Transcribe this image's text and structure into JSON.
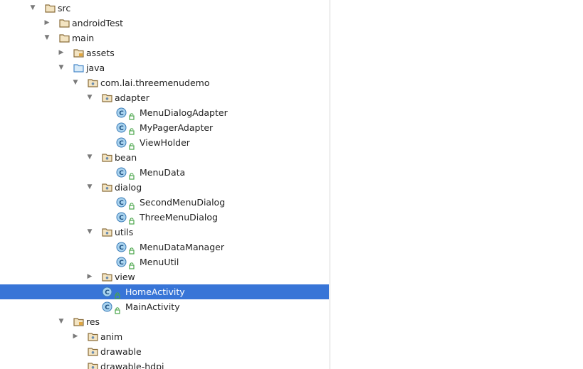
{
  "tree": {
    "rows": [
      {
        "label": "src",
        "icon": "folder-icon",
        "toggle": "expanded",
        "depth": 0,
        "locked": false,
        "selected": false
      },
      {
        "label": "androidTest",
        "icon": "folder-icon",
        "toggle": "collapsed",
        "depth": 1,
        "locked": false,
        "selected": false
      },
      {
        "label": "main",
        "icon": "folder-icon",
        "toggle": "expanded",
        "depth": 1,
        "locked": false,
        "selected": false
      },
      {
        "label": "assets",
        "icon": "resource-folder-icon",
        "toggle": "collapsed",
        "depth": 2,
        "locked": false,
        "selected": false
      },
      {
        "label": "java",
        "icon": "source-folder-icon",
        "toggle": "expanded",
        "depth": 2,
        "locked": false,
        "selected": false
      },
      {
        "label": "com.lai.threemenudemo",
        "icon": "package-icon",
        "toggle": "expanded",
        "depth": 3,
        "locked": false,
        "selected": false
      },
      {
        "label": "adapter",
        "icon": "package-icon",
        "toggle": "expanded",
        "depth": 4,
        "locked": false,
        "selected": false
      },
      {
        "label": "MenuDialogAdapter",
        "icon": "class-icon",
        "toggle": "none",
        "depth": 5,
        "locked": true,
        "selected": false
      },
      {
        "label": "MyPagerAdapter",
        "icon": "class-icon",
        "toggle": "none",
        "depth": 5,
        "locked": true,
        "selected": false
      },
      {
        "label": "ViewHolder",
        "icon": "class-icon",
        "toggle": "none",
        "depth": 5,
        "locked": true,
        "selected": false
      },
      {
        "label": "bean",
        "icon": "package-icon",
        "toggle": "expanded",
        "depth": 4,
        "locked": false,
        "selected": false
      },
      {
        "label": "MenuData",
        "icon": "class-icon",
        "toggle": "none",
        "depth": 5,
        "locked": true,
        "selected": false
      },
      {
        "label": "dialog",
        "icon": "package-icon",
        "toggle": "expanded",
        "depth": 4,
        "locked": false,
        "selected": false
      },
      {
        "label": "SecondMenuDialog",
        "icon": "class-icon",
        "toggle": "none",
        "depth": 5,
        "locked": true,
        "selected": false
      },
      {
        "label": "ThreeMenuDialog",
        "icon": "class-icon",
        "toggle": "none",
        "depth": 5,
        "locked": true,
        "selected": false
      },
      {
        "label": "utils",
        "icon": "package-icon",
        "toggle": "expanded",
        "depth": 4,
        "locked": false,
        "selected": false
      },
      {
        "label": "MenuDataManager",
        "icon": "class-icon",
        "toggle": "none",
        "depth": 5,
        "locked": true,
        "selected": false
      },
      {
        "label": "MenuUtil",
        "icon": "class-icon",
        "toggle": "none",
        "depth": 5,
        "locked": true,
        "selected": false
      },
      {
        "label": "view",
        "icon": "package-icon",
        "toggle": "collapsed",
        "depth": 4,
        "locked": false,
        "selected": false
      },
      {
        "label": "HomeActivity",
        "icon": "class-icon",
        "toggle": "none",
        "depth": 4,
        "locked": true,
        "selected": true
      },
      {
        "label": "MainActivity",
        "icon": "class-icon",
        "toggle": "none",
        "depth": 4,
        "locked": true,
        "selected": false
      },
      {
        "label": "res",
        "icon": "resource-folder-icon",
        "toggle": "expanded",
        "depth": 2,
        "locked": false,
        "selected": false
      },
      {
        "label": "anim",
        "icon": "package-icon",
        "toggle": "collapsed",
        "depth": 3,
        "locked": false,
        "selected": false
      },
      {
        "label": "drawable",
        "icon": "package-icon",
        "toggle": "none",
        "depth": 3,
        "locked": false,
        "selected": false
      },
      {
        "label": "drawable-hdpi",
        "icon": "package-icon",
        "toggle": "none",
        "depth": 3,
        "locked": false,
        "selected": false
      }
    ]
  },
  "colors": {
    "selection": "#3875d7",
    "folder_stroke": "#8a6d3b",
    "folder_fill": "#f3e4c2",
    "source_folder_stroke": "#4a8ac9",
    "class_fill": "#a9d3ef",
    "class_stroke": "#3b7cb8",
    "lock": "#4aa54a"
  }
}
